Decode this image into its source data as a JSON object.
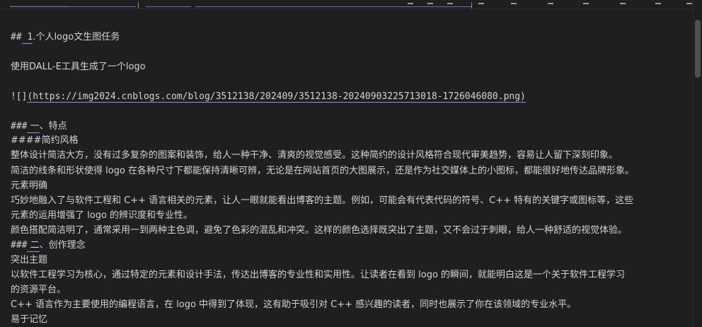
{
  "editor": {
    "top_fragment": "|   |                              |",
    "lines": [
      {
        "prefix": "##",
        "link_part": " 1",
        "text": ".个人logo文生图任务"
      },
      {
        "text": "使用DALL-E工具生成了一个logo"
      },
      {
        "prefix": "![]",
        "link_part": "(https://img2024.cnblogs.com/blog/3512138/202409/3512138-20240903225713018-1726046080.png)"
      },
      {
        "prefix": "###",
        "link_part": " 一",
        "text": "、特点"
      },
      {
        "text": "####简约风格"
      },
      {
        "text": "  整体设计简洁大方，没有过多复杂的图案和装饰，给人一种干净、清爽的视觉感受。这种简约的设计风格符合现代审美趋势，容易让人留下深刻印象。"
      },
      {
        "text": "简洁的线条和形状使得 logo 在各种尺寸下都能保持清晰可辨，无论是在网站首页的大图展示，还是作为社交媒体上的小图标，都能很好地传达品牌形象。"
      },
      {
        "text": "元素明确"
      },
      {
        "text": "  巧妙地融入了与软件工程和 C++ 语言相关的元素，让人一眼就能看出博客的主题。例如，可能会有代表代码的符号、C++ 特有的关键字或图标等，这些"
      },
      {
        "text": "元素的运用增强了 logo 的辨识度和专业性。"
      },
      {
        "text": "颜色搭配简洁明了，通常采用一到两种主色调，避免了色彩的混乱和冲突。这样的颜色选择既突出了主题，又不会过于刺眼，给人一种舒适的视觉体验。"
      },
      {
        "prefix": "###",
        "link_part": " 二",
        "text": "、创作理念"
      },
      {
        "text": "突出主题"
      },
      {
        "text": "  以软件工程学习为核心，通过特定的元素和设计手法，传达出博客的专业性和实用性。让读者在看到 logo 的瞬间，就能明白这是一个关于软件工程学习"
      },
      {
        "text": "的资源平台。"
      },
      {
        "text": "C++ 语言作为主要使用的编程语言，在 logo 中得到了体现，这有助于吸引对 C++ 感兴趣的读者，同时也展示了你在该领域的专业水平。"
      },
      {
        "text": "易于记忆"
      }
    ]
  }
}
